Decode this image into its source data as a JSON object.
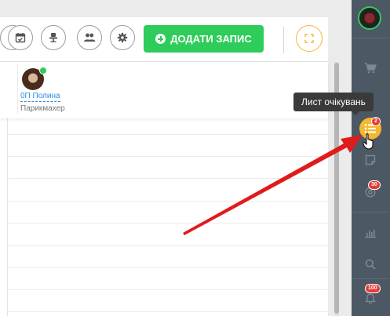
{
  "toolbar": {
    "buttons": [
      {
        "name": "calendar-check-icon"
      },
      {
        "name": "workplace-chair-icon"
      },
      {
        "name": "users-icon"
      },
      {
        "name": "settings-gear-icon"
      }
    ],
    "add_label": "ДОДАТИ ЗАПИС",
    "fullscreen_icon": "fullscreen-icon"
  },
  "staff": {
    "name": "0П Полина",
    "role": "Парикмахер",
    "online": true
  },
  "sidebar": {
    "items": [
      {
        "icon": "cart-icon"
      },
      {
        "icon": "waiting-list-icon",
        "badge": "2",
        "active": true
      },
      {
        "icon": "note-icon"
      },
      {
        "icon": "at-icon",
        "badge": "30"
      },
      {
        "icon": "chart-icon"
      },
      {
        "icon": "search-icon"
      },
      {
        "icon": "bell-icon",
        "badge": "100"
      }
    ]
  },
  "tooltip": {
    "text": "Лист очікувань"
  },
  "colors": {
    "accent_green": "#2ecc5a",
    "sidebar_bg": "#4c5863",
    "highlight_orange": "#f5b730",
    "badge_red": "#e53935",
    "arrow_red": "#e01b1b"
  }
}
